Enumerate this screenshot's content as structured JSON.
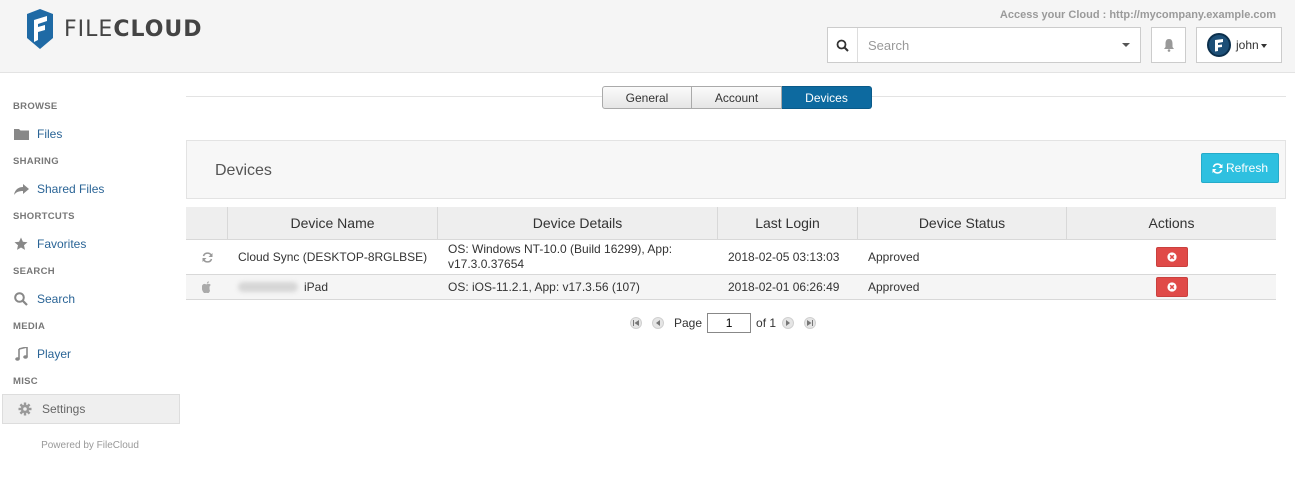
{
  "header": {
    "logo_light": "FILE",
    "logo_bold": "CLOUD",
    "access_text": "Access your Cloud : http://mycompany.example.com",
    "search_placeholder": "Search",
    "username": "john"
  },
  "sidebar": {
    "sections": [
      {
        "title": "BROWSE",
        "items": [
          {
            "label": "Files",
            "icon": "folder-icon"
          }
        ]
      },
      {
        "title": "SHARING",
        "items": [
          {
            "label": "Shared Files",
            "icon": "share-icon"
          }
        ]
      },
      {
        "title": "SHORTCUTS",
        "items": [
          {
            "label": "Favorites",
            "icon": "star-icon"
          }
        ]
      },
      {
        "title": "SEARCH",
        "items": [
          {
            "label": "Search",
            "icon": "search-icon"
          }
        ]
      },
      {
        "title": "MEDIA",
        "items": [
          {
            "label": "Player",
            "icon": "music-icon"
          }
        ]
      },
      {
        "title": "MISC",
        "items": [
          {
            "label": "Settings",
            "icon": "gear-icon",
            "active": true
          }
        ]
      }
    ],
    "powered_by": "Powered by FileCloud"
  },
  "tabs": [
    {
      "label": "General",
      "active": false
    },
    {
      "label": "Account",
      "active": false
    },
    {
      "label": "Devices",
      "active": true
    }
  ],
  "panel": {
    "title": "Devices",
    "refresh_label": "Refresh"
  },
  "table": {
    "columns": [
      "",
      "Device Name",
      "Device Details",
      "Last Login",
      "Device Status",
      "Actions"
    ],
    "rows": [
      {
        "icon": "sync-icon",
        "name": "Cloud Sync (DESKTOP-8RGLBSE)",
        "details_line1": "OS: Windows NT-10.0 (Build 16299), App:",
        "details_line2": "v17.3.0.37654",
        "last_login": "2018-02-05 03:13:03",
        "status": "Approved"
      },
      {
        "icon": "apple-icon",
        "name": "iPad",
        "details_line1": "OS: iOS-11.2.1, App: v17.3.56 (107)",
        "details_line2": "",
        "last_login": "2018-02-01 06:26:49",
        "status": "Approved"
      }
    ]
  },
  "pager": {
    "page_label": "Page",
    "current_page": "1",
    "of_label": "of 1"
  },
  "colors": {
    "active_tab": "#0d6aa0",
    "refresh_button": "#2ec0e0",
    "delete_button": "#e04a48",
    "link": "#2a6496"
  }
}
